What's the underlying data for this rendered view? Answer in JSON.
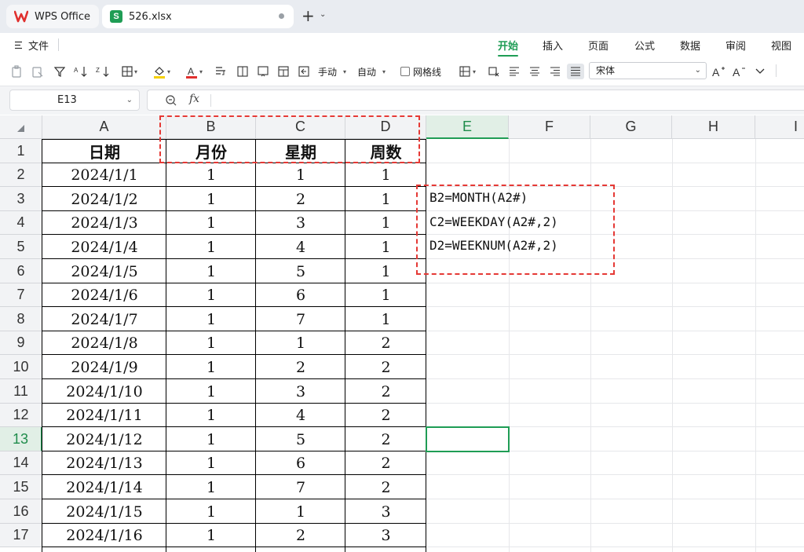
{
  "tabs": {
    "home_tab": "WPS Office",
    "file_tab": "526.xlsx"
  },
  "menu": {
    "file_label": "文件",
    "items": [
      "开始",
      "插入",
      "页面",
      "公式",
      "数据",
      "审阅",
      "视图"
    ],
    "active": "开始"
  },
  "toolbar": {
    "manual_label": "手动",
    "auto_label": "自动",
    "gridline_label": "网格线",
    "font_name": "宋体"
  },
  "formula_bar": {
    "cell_ref": "E13",
    "fx_label": "fx",
    "formula": ""
  },
  "grid": {
    "columns": [
      "A",
      "B",
      "C",
      "D",
      "E",
      "F",
      "G",
      "H",
      "I"
    ],
    "rows": [
      "1",
      "2",
      "3",
      "4",
      "5",
      "6",
      "7",
      "8",
      "9",
      "10",
      "11",
      "12",
      "13",
      "14",
      "15",
      "16",
      "17"
    ],
    "selected_column": "E",
    "selected_row": "13"
  },
  "table": {
    "headers": [
      "日期",
      "月份",
      "星期",
      "周数"
    ],
    "rows": [
      [
        "2024/1/1",
        "1",
        "1",
        "1"
      ],
      [
        "2024/1/2",
        "1",
        "2",
        "1"
      ],
      [
        "2024/1/3",
        "1",
        "3",
        "1"
      ],
      [
        "2024/1/4",
        "1",
        "4",
        "1"
      ],
      [
        "2024/1/5",
        "1",
        "5",
        "1"
      ],
      [
        "2024/1/6",
        "1",
        "6",
        "1"
      ],
      [
        "2024/1/7",
        "1",
        "7",
        "1"
      ],
      [
        "2024/1/8",
        "1",
        "1",
        "2"
      ],
      [
        "2024/1/9",
        "1",
        "2",
        "2"
      ],
      [
        "2024/1/10",
        "1",
        "3",
        "2"
      ],
      [
        "2024/1/11",
        "1",
        "4",
        "2"
      ],
      [
        "2024/1/12",
        "1",
        "5",
        "2"
      ],
      [
        "2024/1/13",
        "1",
        "6",
        "2"
      ],
      [
        "2024/1/14",
        "1",
        "7",
        "2"
      ],
      [
        "2024/1/15",
        "1",
        "1",
        "3"
      ],
      [
        "2024/1/16",
        "1",
        "2",
        "3"
      ]
    ]
  },
  "notes": [
    "B2=MONTH(A2#)",
    "C2=WEEKDAY(A2#,2)",
    "D2=WEEKNUM(A2#,2)"
  ],
  "colors": {
    "accent": "#1f9d55",
    "annotation_dash": "#e53935"
  }
}
